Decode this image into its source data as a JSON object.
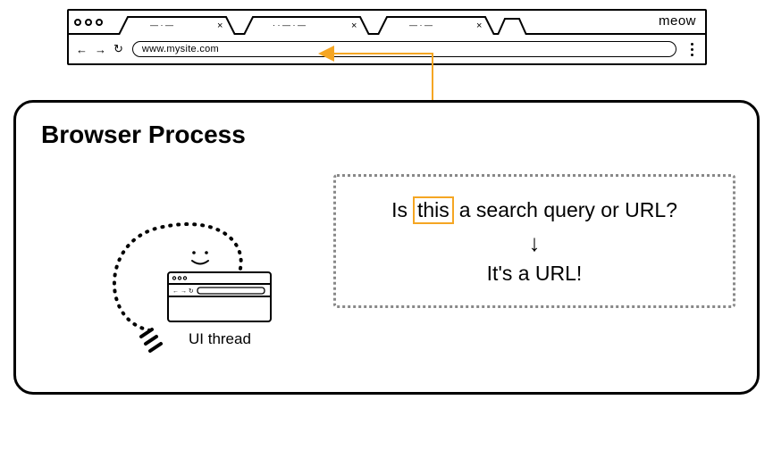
{
  "chrome": {
    "browser_name": "meow",
    "url": "www.mysite.com",
    "tabs": [
      {
        "label": "— · —"
      },
      {
        "label": "· · — · —"
      },
      {
        "label": "— · —"
      }
    ]
  },
  "process": {
    "title": "Browser Process",
    "thread_label": "UI thread"
  },
  "thought": {
    "question_prefix": "Is",
    "question_highlight": "this",
    "question_suffix": "a search query or URL?",
    "answer": "It's a URL!"
  },
  "colors": {
    "accent": "#f5a623"
  }
}
